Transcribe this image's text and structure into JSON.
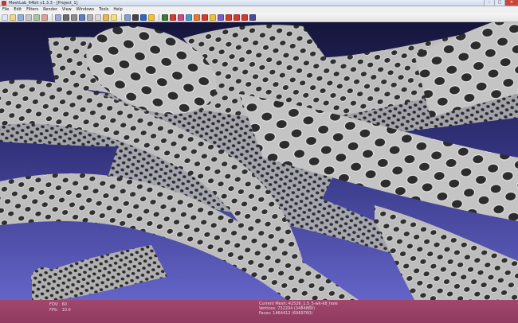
{
  "window": {
    "title": "MeshLab_64bit v1.3.3 - [Project_1]",
    "minimize": "–",
    "maximize": "□",
    "close": "✕"
  },
  "menu": [
    "File",
    "Edit",
    "Filters",
    "Render",
    "View",
    "Windows",
    "Tools",
    "Help"
  ],
  "toolbar": {
    "icons": [
      "new-project-icon",
      "open-icon",
      "save-icon",
      "import-mesh-icon",
      "export-mesh-icon",
      "reload-icon",
      "snapshot-icon",
      "points-render-icon",
      "wireframe-render-icon",
      "hidden-lines-icon",
      "flat-render-icon",
      "smooth-render-icon",
      "texture-icon",
      "light-icon",
      "backface-icon",
      "trackball-icon",
      "layer-dialog-icon",
      "info-icon",
      "measure-icon",
      "pick-points-icon",
      "select-vertices-icon",
      "select-faces-icon",
      "paint-icon",
      "align-icon",
      "color-icon",
      "quality-icon",
      "select-connected-icon",
      "delete-faces-icon",
      "delete-vertices-icon",
      "filter-icon"
    ],
    "colors": {
      "bg": "#ececec",
      "accent_yellow": "#f2c12e",
      "accent_red": "#d23b2f",
      "accent_blue": "#2f63c8"
    }
  },
  "viewport": {
    "background_top": "#15153a",
    "background_bottom": "#6464c8",
    "mesh_color": "#b9b9b9"
  },
  "status": {
    "fov_label": "FOV:",
    "fov_value": "60",
    "fps_label": "FPS:",
    "fps_value": "10.0",
    "current_mesh": "Current Mesh: 42526_1.5_5-wk-k8_hole",
    "vertices": "Vertices: 732204 (3484880)",
    "faces": "Faces: 1464412 (6969760)",
    "background_color": "#9b4468"
  }
}
